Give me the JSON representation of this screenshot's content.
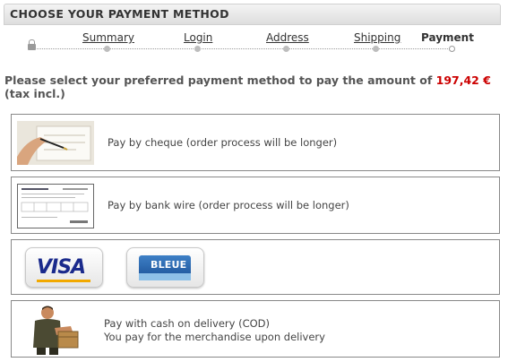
{
  "header": {
    "title": "CHOOSE YOUR PAYMENT METHOD"
  },
  "steps": [
    {
      "label": "Summary"
    },
    {
      "label": "Login"
    },
    {
      "label": "Address"
    },
    {
      "label": "Shipping"
    },
    {
      "label": "Payment",
      "current": true
    }
  ],
  "intro": {
    "text_before": "Please select your preferred payment method to pay the amount of ",
    "amount": "197,42 €",
    "text_after": " (tax incl.)"
  },
  "options": {
    "cheque": {
      "label": "Pay by cheque (order process will be longer)"
    },
    "bankwire": {
      "label": "Pay by bank wire (order process will be longer)"
    },
    "cards": {
      "visa": "VISA",
      "cb": "BLEUE"
    },
    "cod": {
      "label": "Pay with cash on delivery (COD)",
      "sublabel": "You pay for the merchandise upon delivery"
    }
  },
  "colors": {
    "amount": "#cc0000",
    "border": "#888888"
  }
}
